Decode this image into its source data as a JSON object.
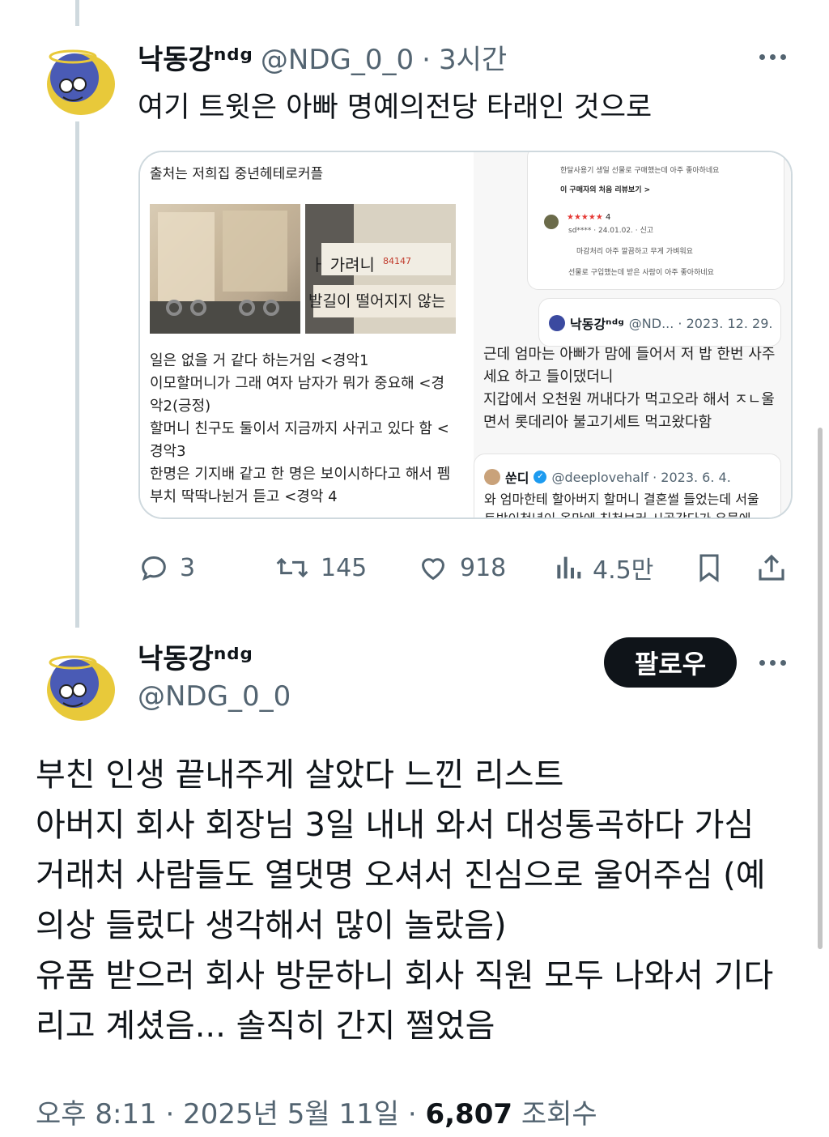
{
  "tweet1": {
    "display_name": "낙동강ⁿᵈᵍ",
    "handle": "@NDG_0_0",
    "separator": "·",
    "time": "3시간",
    "text": "여기 트윗은 아빠 명예의전당 타래인 것으로",
    "media": {
      "left_caption": "출처는 저희집 중년헤테로커플",
      "left_lines": [
        "일은 없을 거 같다 하는거임 <경악1",
        "이모할머니가 그래 여자 남자가 뭐가 중요해 <경",
        "악2(긍정)",
        "할머니 친구도 둘이서 지금까지 사귀고 있다 함 <",
        "경악3",
        "한명은 기지배 같고 한 명은 보이시하다고 해서 펨",
        "부치 딱딱나뉜거 듣고 <경악 4"
      ],
      "photo_b_handwriting": "ㅏ 가려니",
      "photo_b_handwriting2": "발길이 떨어지지 않는",
      "photo_b_number": "84147",
      "review_lines": [
        "한달사용기  생일 선물로 구매했는데 아주 좋아하네요",
        "이 구매자의 처음 리뷰보기 >",
        "sd****  ·  24.01.02.  ·  신고",
        "마감처리 아주 깔끔하고  무게 가벼워요",
        "선물로 구입했는데 받은 사람이 아주 좋아하네요"
      ],
      "review_stars": "★★★★★",
      "review_score": "4",
      "quote1": {
        "name": "낙동강ⁿᵈᵍ",
        "meta": "@ND... · 2023. 12. 29."
      },
      "right_lines": [
        "근데 엄마는 아빠가 맘에 들어서 저 밥 한번 사주",
        "세요 하고 들이댔더니",
        "지갑에서 오천원 꺼내다가 먹고오라 해서 ㅈㄴ울",
        "면서 롯데리아 불고기세트 먹고왔다함"
      ],
      "quote2": {
        "name": "쑨디",
        "verified": "✓",
        "meta": "@deeplovehalf · 2023. 6. 4.",
        "body": [
          "와 엄마한테 할아버지 할머니 결혼썰 들었는데 서울",
          "토박이청년이 올만에 친척보러 시골갔다가 우물에"
        ]
      }
    },
    "actions": {
      "replies": "3",
      "retweets": "145",
      "likes": "918",
      "views": "4.5만"
    }
  },
  "tweet2": {
    "display_name": "낙동강ⁿᵈᵍ",
    "handle": "@NDG_0_0",
    "follow_label": "팔로우",
    "body_lines": [
      "부친 인생 끝내주게 살았다 느낀 리스트",
      "아버지 회사 회장님 3일 내내 와서 대성통곡하다 가심",
      "거래처 사람들도 열댓명 오셔서 진심으로 울어주심 (예",
      "의상 들렀다 생각해서 많이 놀랐음)",
      "유품 받으러 회사 방문하니 회사 직원 모두 나와서 기다",
      "리고 계셨음... 솔직히 간지 쩔었음"
    ],
    "meta": {
      "time": "오후 8:11",
      "dot": "·",
      "date": "2025년 5월 11일",
      "views_count": "6,807",
      "views_label": "조회수"
    }
  },
  "colors": {
    "text": "#0f1419",
    "muted": "#536471",
    "border": "#cfd9de",
    "follow_bg": "#0f1419",
    "verified": "#1d9bf0"
  }
}
